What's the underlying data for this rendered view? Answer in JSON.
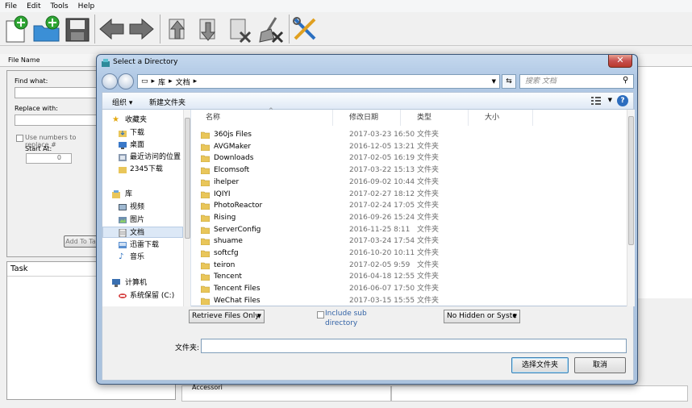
{
  "menu": [
    "File",
    "Edit",
    "Tools",
    "Help"
  ],
  "app": {
    "file_name_label": "File Name",
    "find_what_label": "Find what:",
    "replace_with_label": "Replace with:",
    "use_numbers_label": "Use numbers to replace #",
    "start_at_label": "Start At:",
    "start_at_value": "0",
    "add_button": "Add To Ta",
    "task_title": "Task",
    "bottom_text": "Accessori"
  },
  "dialog": {
    "title": "Select a Directory",
    "breadcrumb": [
      "库",
      "文档"
    ],
    "search_placeholder": "搜索 文档",
    "organize": "组织 ▾",
    "new_folder": "新建文件夹",
    "columns": {
      "name": "名称",
      "date": "修改日期",
      "type": "类型",
      "size": "大小"
    },
    "nav": {
      "favorites": "收藏夹",
      "downloads": "下载",
      "desktop": "桌面",
      "recent": "最近访问的位置",
      "d2345": "2345下载",
      "libraries": "库",
      "videos": "视频",
      "pictures": "图片",
      "documents": "文档",
      "xunlei": "迅雷下载",
      "music": "音乐",
      "computer": "计算机",
      "system_drive": "系统保留 (C:)"
    },
    "files": [
      {
        "name": "360js Files",
        "date": "2017-03-23 16:50",
        "type": "文件夹"
      },
      {
        "name": "AVGMaker",
        "date": "2016-12-05 13:21",
        "type": "文件夹"
      },
      {
        "name": "Downloads",
        "date": "2017-02-05 16:19",
        "type": "文件夹"
      },
      {
        "name": "Elcomsoft",
        "date": "2017-03-22 15:13",
        "type": "文件夹"
      },
      {
        "name": "ihelper",
        "date": "2016-09-02 10:44",
        "type": "文件夹"
      },
      {
        "name": "IQIYI",
        "date": "2017-02-27 18:12",
        "type": "文件夹"
      },
      {
        "name": "PhotoReactor",
        "date": "2017-02-24 17:05",
        "type": "文件夹"
      },
      {
        "name": "Rising",
        "date": "2016-09-26 15:24",
        "type": "文件夹"
      },
      {
        "name": "ServerConfig",
        "date": "2016-11-25 8:11",
        "type": "文件夹"
      },
      {
        "name": "shuame",
        "date": "2017-03-24 17:54",
        "type": "文件夹"
      },
      {
        "name": "softcfg",
        "date": "2016-10-20 10:11",
        "type": "文件夹"
      },
      {
        "name": "teiron",
        "date": "2017-02-05 9:59",
        "type": "文件夹"
      },
      {
        "name": "Tencent",
        "date": "2016-04-18 12:55",
        "type": "文件夹"
      },
      {
        "name": "Tencent Files",
        "date": "2016-06-07 17:50",
        "type": "文件夹"
      },
      {
        "name": "WeChat Files",
        "date": "2017-03-15 15:55",
        "type": "文件夹"
      }
    ],
    "retrieve_select": "Retrieve Files Only",
    "include_sub_1": "Include sub",
    "include_sub_2": "directory",
    "hidden_select": "No Hidden or Syste",
    "folder_label": "文件夹:",
    "folder_value": "",
    "ok_button": "选择文件夹",
    "cancel_button": "取消"
  },
  "colors": {
    "folder": "#e9c65a",
    "accent": "#3363a6",
    "close": "#c75050"
  }
}
